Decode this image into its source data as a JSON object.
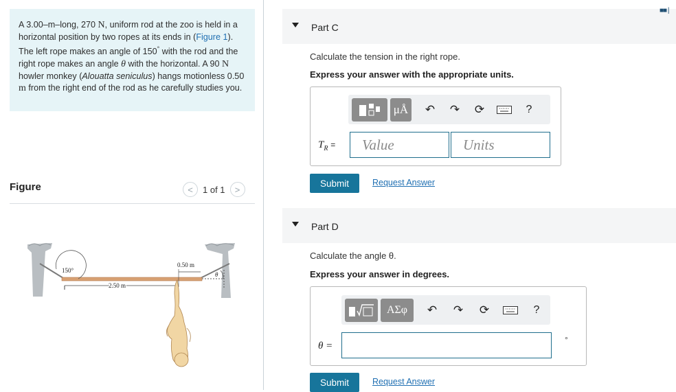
{
  "problem": {
    "text_1": "A 3.00–m–long, 270 ",
    "unit_N1": "N",
    "text_2": ", uniform rod at the zoo is held in a horizontal position by two ropes at its ends in (",
    "figure_link": "Figure 1",
    "text_3": "). The left rope makes an angle of 150",
    "degree": "°",
    "text_4": " with the rod and the right rope makes an angle ",
    "theta": "θ",
    "text_5": " with the horizontal. A 90 ",
    "unit_N2": "N",
    "text_6": " howler monkey (",
    "species": "Alouatta seniculus",
    "text_7": ") hangs motionless 0.50 ",
    "unit_m": "m",
    "text_8": " from the right end of the rod as he carefully studies you."
  },
  "figure": {
    "label": "Figure",
    "pager_text": "1 of 1",
    "prev": "<",
    "next": ">",
    "angle_left": "150°",
    "dim_long": "2.50 m",
    "dim_short": "0.50 m",
    "angle_right": "θ"
  },
  "part_c": {
    "title": "Part C",
    "question": "Calculate the tension in the right rope.",
    "instruction": "Express your answer with the appropriate units.",
    "var_label": "T",
    "var_sub": "R",
    "equals": "=",
    "value_placeholder": "Value",
    "units_placeholder": "Units",
    "tool_units_btn": "μÅ",
    "tool_help": "?",
    "submit": "Submit",
    "request": "Request Answer"
  },
  "part_d": {
    "title": "Part D",
    "question": "Calculate the angle θ.",
    "instruction": "Express your answer in degrees.",
    "var_label": "θ =",
    "unit_suffix": "°",
    "tool_greek_btn": "ΑΣφ",
    "tool_help": "?",
    "submit": "Submit",
    "request": "Request Answer"
  },
  "icons": {
    "undo": "undo-icon",
    "redo": "redo-icon",
    "reset": "reset-icon",
    "keyboard": "keyboard-icon"
  }
}
